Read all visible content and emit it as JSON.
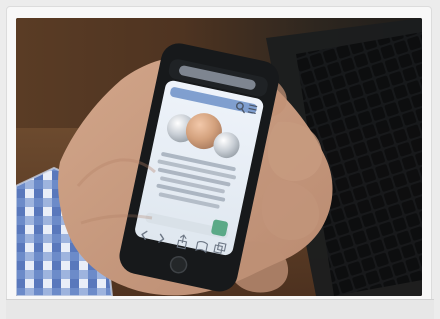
{
  "image": {
    "subject": "hand-holding-smartphone",
    "icons": {
      "share": "share-icon",
      "bookmarks": "bookmarks-icon",
      "tabs": "tabs-icon",
      "back": "back-icon",
      "forward": "forward-icon",
      "search": "search-icon",
      "menu": "menu-icon"
    },
    "colors": {
      "sleeve_blue": "#3f64b2",
      "sleeve_white": "#e9eef8",
      "skin": "#c89b81",
      "phone_black": "#17191b",
      "screen_bg": "#e7edf4",
      "header_blue": "#6c91c8",
      "coin_gold": "#d3a17d",
      "coin_silver": "#c7cdd4",
      "accent_green": "#5ba987"
    }
  }
}
